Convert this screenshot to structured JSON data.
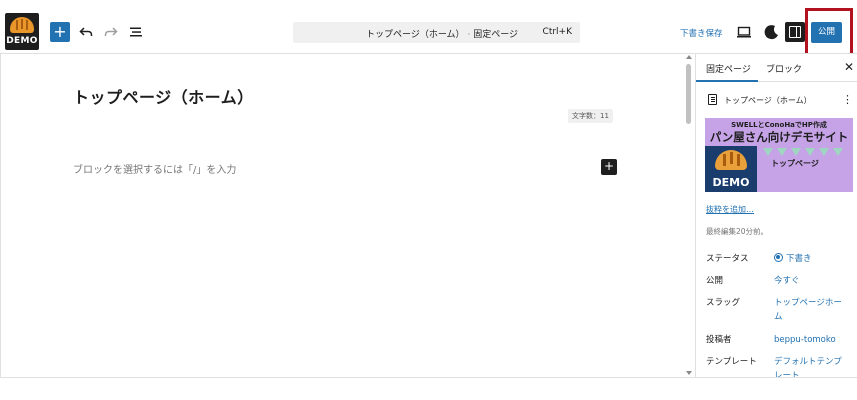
{
  "header": {
    "logo_text": "DEMO",
    "command_title": "トップページ（ホーム）",
    "command_separator": "·",
    "command_type": "固定ページ",
    "command_shortcut": "Ctrl+K",
    "save_draft_label": "下書き保存",
    "publish_label": "公開",
    "accent_color": "#2271b1",
    "highlight_color": "#b2121f",
    "icons": [
      "add-block-icon",
      "undo-icon",
      "redo-icon",
      "document-overview-icon",
      "view-icon",
      "style-icon",
      "settings-icon"
    ]
  },
  "editor": {
    "page_title": "トップページ（ホーム）",
    "word_count": "文字数：11",
    "block_placeholder": "ブロックを選択するには「/」を入力"
  },
  "sidebar": {
    "tabs": [
      "固定ページ",
      "ブロック"
    ],
    "active_tab": "固定ページ",
    "document_title": "トップページ（ホーム）",
    "featured_image": {
      "line1": "SWELLとConoHaでHP作成",
      "line2": "パン屋さん向けデモサイト",
      "logo_text": "DEMO",
      "label": "トップページ"
    },
    "excerpt_link": "抜粋を追加…",
    "last_edited": "最終編集20分前。",
    "meta": [
      {
        "label": "ステータス",
        "value": "下書き"
      },
      {
        "label": "公開",
        "value": "今すぐ"
      },
      {
        "label": "スラッグ",
        "value": "トップページホーム"
      },
      {
        "label": "投稿者",
        "value": "beppu-tomoko"
      },
      {
        "label": "テンプレート",
        "value": "デフォルトテンプレート"
      }
    ]
  }
}
